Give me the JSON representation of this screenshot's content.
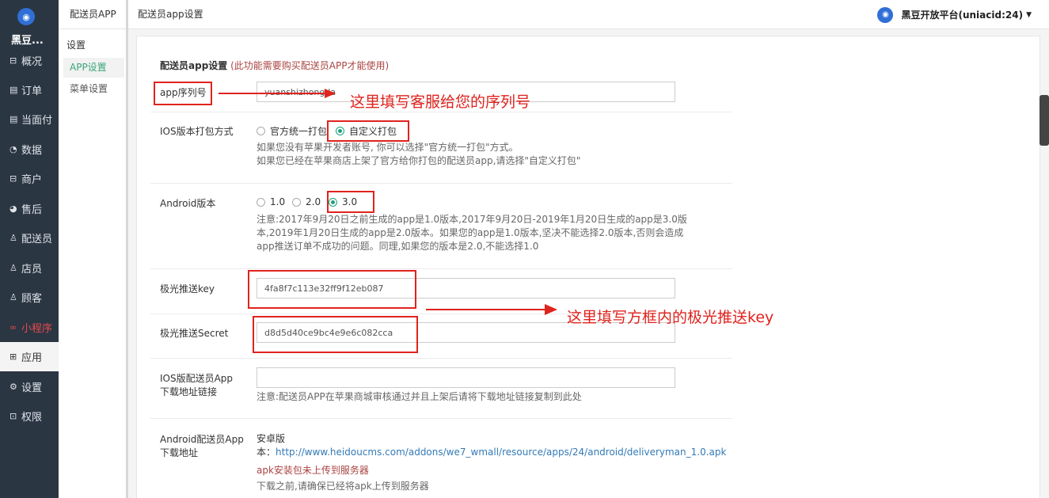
{
  "sidebar": {
    "brand": "黑豆...",
    "items": [
      {
        "label": "概况",
        "icon": "dashboard-icon",
        "glyph": "⊟"
      },
      {
        "label": "订单",
        "icon": "order-icon",
        "glyph": "▤"
      },
      {
        "label": "当面付",
        "icon": "pay-icon",
        "glyph": "▤"
      },
      {
        "label": "数据",
        "icon": "data-icon",
        "glyph": "◔"
      },
      {
        "label": "商户",
        "icon": "store-icon",
        "glyph": "⊟"
      },
      {
        "label": "售后",
        "icon": "aftersale-icon",
        "glyph": "◕"
      },
      {
        "label": "配送员",
        "icon": "courier-icon",
        "glyph": "♙"
      },
      {
        "label": "店员",
        "icon": "clerk-icon",
        "glyph": "♙"
      },
      {
        "label": "顾客",
        "icon": "customer-icon",
        "glyph": "♙"
      },
      {
        "label": "小程序",
        "icon": "miniprogram-icon",
        "glyph": "∞"
      },
      {
        "label": "应用",
        "icon": "apps-icon",
        "glyph": "⊞"
      },
      {
        "label": "设置",
        "icon": "gear-icon",
        "glyph": "⚙"
      },
      {
        "label": "权限",
        "icon": "lock-icon",
        "glyph": "⊡"
      }
    ]
  },
  "subnav": {
    "header": "配送员APP",
    "title": "设置",
    "items": [
      "APP设置",
      "菜单设置"
    ]
  },
  "topbar": {
    "breadcrumb": "配送员app设置",
    "user": "黑豆开放平台(uniacid:24)"
  },
  "form": {
    "section_title": "配送员app设置",
    "section_hint": "(此功能需要购买配送员APP才能使用)",
    "serial": {
      "label": "app序列号",
      "value": "yuanshizhongda"
    },
    "ios_pack": {
      "label": "IOS版本打包方式",
      "options": [
        "官方统一打包",
        "自定义打包"
      ],
      "selected": "自定义打包",
      "help1": "如果您没有苹果开发者账号, 你可以选择\"官方统一打包\"方式。",
      "help2": "如果您已经在苹果商店上架了官方给你打包的配送员app,请选择\"自定义打包\""
    },
    "android": {
      "label": "Android版本",
      "options": [
        "1.0",
        "2.0",
        "3.0"
      ],
      "selected": "3.0",
      "help1": "注意:2017年9月20日之前生成的app是1.0版本,2017年9月20日-2019年1月20日生成的app是3.0版",
      "help2": "本,2019年1月20日生成的app是2.0版本。如果您的app是1.0版本,坚决不能选择2.0版本,否则会造成",
      "help3": "app推送订单不成功的问题。同理,如果您的版本是2.0,不能选择1.0"
    },
    "jpush_key": {
      "label": "极光推送key",
      "value": "4fa8f7c113e32ff9f12eb087"
    },
    "jpush_secret": {
      "label": "极光推送Secret",
      "value": "d8d5d40ce9bc4e9e6c082cca"
    },
    "ios_link": {
      "label1": "IOS版配送员App",
      "label2": "下载地址链接",
      "value": "",
      "help": "注意:配送员APP在苹果商城审核通过并且上架后请将下载地址链接复制到此处"
    },
    "android_dl": {
      "label1": "Android配送员App",
      "label2": "下载地址",
      "line1": "安卓版",
      "line2_prefix": "本：",
      "url": "http://www.heidoucms.com/addons/we7_wmall/resource/apps/24/android/deliveryman_1.0.apk",
      "error": "apk安装包未上传到服务器",
      "note": "下载之前,请确保已经将apk上传到服务器"
    }
  },
  "annotations": {
    "serial_note": "这里填写客服给您的序列号",
    "jpush_note": "这里填写方框内的极光推送key",
    "color": "#e0231d"
  }
}
